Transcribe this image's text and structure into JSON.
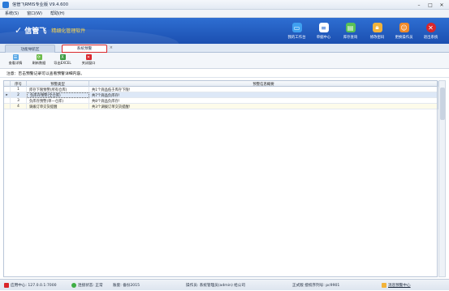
{
  "window": {
    "title": "信管飞RMIS专业版 V9.4.600"
  },
  "menu": [
    "系统(S)",
    "窗口(W)",
    "帮助(H)"
  ],
  "banner": {
    "brand": "信管飞",
    "slogan": "精细化管理软件"
  },
  "tools": [
    {
      "label": "我的工作台",
      "icon": "monitor-icon",
      "color": "#3fa0f0"
    },
    {
      "label": "单据中心",
      "icon": "documents-icon",
      "color": "#ffffff"
    },
    {
      "label": "库存查询",
      "icon": "inventory-icon",
      "color": "#59c156"
    },
    {
      "label": "修改密码",
      "icon": "lock-icon",
      "color": "#f2b33a"
    },
    {
      "label": "更换操作员",
      "icon": "user-icon",
      "color": "#f08a2a"
    },
    {
      "label": "退出系统",
      "icon": "exit-icon",
      "color": "#d9262b"
    }
  ],
  "tabs": [
    {
      "label": "功能导航区"
    },
    {
      "label": "系统预警"
    }
  ],
  "toolbar": [
    {
      "label": "查看详情",
      "color": "#5aa8e6"
    },
    {
      "label": "刷新数据",
      "color": "#6cbb4a"
    },
    {
      "label": "导出EXCEL",
      "color": "#3f9c44"
    },
    {
      "label": "关闭窗口",
      "color": "#d9262b"
    }
  ],
  "note": "注意：否击预警记录可以查看预警详细内容。",
  "grid": {
    "columns": [
      "序号",
      "预警类型",
      "预警信息概要"
    ],
    "rows": [
      {
        "no": "1",
        "type": "库存下限预警(所有仓库)",
        "summary": "共1个商品低于库存下限!"
      },
      {
        "no": "2",
        "type": "负库存预警(全仓库)",
        "summary": "共7个商品负库存!"
      },
      {
        "no": "3",
        "type": "负库存预警(单一仓库)",
        "summary": "共8个商品负库存!"
      },
      {
        "no": "4",
        "type": "调拨订单交货提醒",
        "summary": "共3个调拨订单交货提醒!"
      }
    ]
  },
  "status": {
    "server": "应用中心: 127.0.0.1:7000",
    "connection": "连接状态: 正常",
    "account": "账套: 备份2015",
    "operator": "操作员: 系统管理员(admin) 给公司",
    "version": "正式版  授权序列号: pc9901",
    "warning_center": "消息预警中心"
  }
}
